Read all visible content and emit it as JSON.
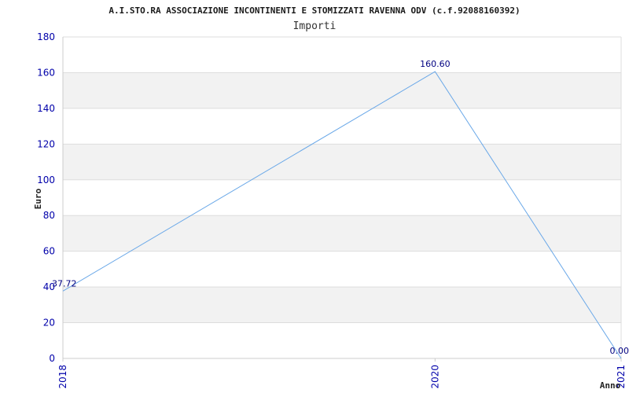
{
  "chart_data": {
    "type": "line",
    "title": "A.I.STO.RA ASSOCIAZIONE INCONTINENTI E STOMIZZATI RAVENNA ODV (c.f.92088160392)",
    "subtitle": "Importi",
    "xlabel": "Anno",
    "ylabel": "Euro",
    "x": [
      "2018",
      "2020",
      "2021"
    ],
    "x_numeric": [
      2018,
      2020,
      2021
    ],
    "xlim": [
      2018,
      2021
    ],
    "ylim": [
      0,
      180
    ],
    "yticks": [
      "0",
      "20",
      "40",
      "60",
      "80",
      "100",
      "120",
      "140",
      "160",
      "180"
    ],
    "series": [
      {
        "values": [
          37.72,
          160.6,
          0.0
        ],
        "labels": [
          "37.72",
          "160.60",
          "0.00"
        ]
      }
    ],
    "grid": true,
    "line_color": "#6aa8e8",
    "band_color": "#f2f2f2",
    "tick_color": "#0000aa",
    "data_label_color": "#000080"
  }
}
